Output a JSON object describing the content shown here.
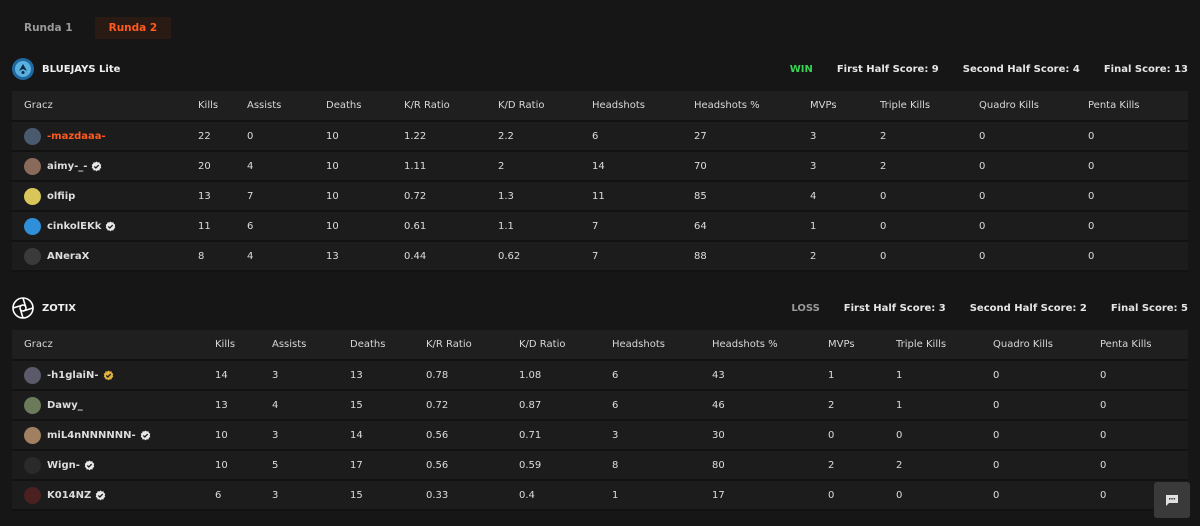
{
  "tabs": [
    {
      "label": "Runda 1",
      "active": false
    },
    {
      "label": "Runda 2",
      "active": true
    }
  ],
  "columns": [
    "Gracz",
    "Kills",
    "Assists",
    "Deaths",
    "K/R Ratio",
    "K/D Ratio",
    "Headshots",
    "Headshots %",
    "MVPs",
    "Triple Kills",
    "Quadro Kills",
    "Penta Kills"
  ],
  "teams": [
    {
      "name": "BLUEJAYS Lite",
      "logo_icon": "bluejays-logo-icon",
      "logo_color": "#2a7fb8",
      "result": "WIN",
      "first_half": "First Half Score: 9",
      "second_half": "Second Half Score: 4",
      "final": "Final Score: 13",
      "players": [
        {
          "name": "-mazdaaa-",
          "highlight": true,
          "verified": false,
          "avatar_color": "#4a5a6e",
          "stats": [
            "22",
            "0",
            "10",
            "1.22",
            "2.2",
            "6",
            "27",
            "3",
            "2",
            "0",
            "0"
          ]
        },
        {
          "name": "aimy-_-",
          "highlight": false,
          "verified": true,
          "avatar_color": "#8a6a5a",
          "stats": [
            "20",
            "4",
            "10",
            "1.11",
            "2",
            "14",
            "70",
            "3",
            "2",
            "0",
            "0"
          ]
        },
        {
          "name": "olfiip",
          "highlight": false,
          "verified": false,
          "avatar_color": "#d8c65a",
          "stats": [
            "13",
            "7",
            "10",
            "0.72",
            "1.3",
            "11",
            "85",
            "4",
            "0",
            "0",
            "0"
          ]
        },
        {
          "name": "cinkolEKk",
          "highlight": false,
          "verified": true,
          "avatar_color": "#2f8fd8",
          "stats": [
            "11",
            "6",
            "10",
            "0.61",
            "1.1",
            "7",
            "64",
            "1",
            "0",
            "0",
            "0"
          ]
        },
        {
          "name": "ANeraX",
          "highlight": false,
          "verified": false,
          "avatar_color": "#3a3a3a",
          "stats": [
            "8",
            "4",
            "13",
            "0.44",
            "0.62",
            "7",
            "88",
            "2",
            "0",
            "0",
            "0"
          ]
        }
      ]
    },
    {
      "name": "ZOTIX",
      "logo_icon": "zotix-logo-icon",
      "logo_color": "#ffffff",
      "result": "LOSS",
      "first_half": "First Half Score: 3",
      "second_half": "Second Half Score: 2",
      "final": "Final Score: 5",
      "players": [
        {
          "name": "-h1glaiN-",
          "highlight": false,
          "verified": true,
          "badge_color": "#e0b040",
          "avatar_color": "#5a5a6a",
          "stats": [
            "14",
            "3",
            "13",
            "0.78",
            "1.08",
            "6",
            "43",
            "1",
            "1",
            "0",
            "0"
          ]
        },
        {
          "name": "Dawy_",
          "highlight": false,
          "verified": false,
          "avatar_color": "#6a7a5a",
          "stats": [
            "13",
            "4",
            "15",
            "0.72",
            "0.87",
            "6",
            "46",
            "2",
            "1",
            "0",
            "0"
          ]
        },
        {
          "name": "miL4nNNNNNN-",
          "highlight": false,
          "verified": true,
          "avatar_color": "#a08060",
          "stats": [
            "10",
            "3",
            "14",
            "0.56",
            "0.71",
            "3",
            "30",
            "0",
            "0",
            "0",
            "0"
          ]
        },
        {
          "name": "Wign-",
          "highlight": false,
          "verified": true,
          "avatar_color": "#2a2a2a",
          "stats": [
            "10",
            "5",
            "17",
            "0.56",
            "0.59",
            "8",
            "80",
            "2",
            "2",
            "0",
            "0"
          ]
        },
        {
          "name": "K014NZ",
          "highlight": false,
          "verified": true,
          "avatar_color": "#4a2020",
          "stats": [
            "6",
            "3",
            "15",
            "0.33",
            "0.4",
            "1",
            "17",
            "0",
            "0",
            "0",
            "0"
          ]
        }
      ]
    }
  ],
  "colors": {
    "accent": "#ff5a1f",
    "win": "#39d353",
    "loss": "#9a9a9a",
    "verified": "#e8e8e8"
  },
  "chat_icon": "chat-icon"
}
